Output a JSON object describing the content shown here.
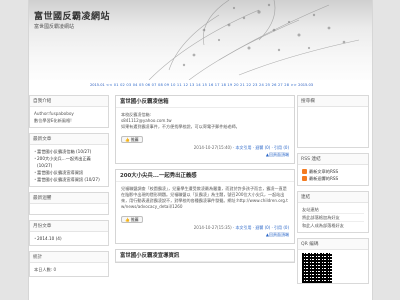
{
  "site": {
    "title": "富世國反霸凌網站",
    "subtitle": "富世國反霸凌網站"
  },
  "calendar": {
    "prev": "2015.01",
    "next": "2015.03",
    "days": "<< 01 02 03 04 05 06 07 08 09 10 11 12 13 14 15 16 17 18 19 20 21 22 23 24 25 26 27 28 >>"
  },
  "left": {
    "about": {
      "title": "自我介紹",
      "lines": [
        "Author:fuspaboboy",
        "數位學習E化新風格!"
      ]
    },
    "recent": {
      "title": "最新文章",
      "items": [
        "富世國小反霸凌信箱 (10/27)",
        "200大小尖兵...一起秀出正義",
        "(10/27)",
        "富世國小反霸凌宣導資訊",
        "富世國小反霸凌宣導資訊 (10/27)"
      ]
    },
    "latest_reply": {
      "title": "最新迴響"
    },
    "archive": {
      "title": "月份文章",
      "items": [
        "2014.10 (4)"
      ]
    },
    "stats": {
      "title": "統計",
      "lines": [
        "本日人數: 0"
      ]
    }
  },
  "posts": [
    {
      "title": "富世國小反霸凌信箱",
      "body": "本校反霸凌信箱:\ns841112@yahoo.com.tw\n如果有遇到霸凌事件，不方便找學校說，可以寄電子郵件給老師。",
      "push": "推薦",
      "meta_date": "2014-10-27(15:40)",
      "meta_stats": "‧ 本文引用 ‧ 迴響 (0) ‧ 引用 (0)",
      "back": "▲回頁面頂端"
    },
    {
      "title": "200大小尖兵...一起秀出正義感",
      "body": "兒福聯盟調查「校園霸凌」，兒童學生遭受欺凌最為嚴重，而對於許多孩子而言，霸凌一直是在陰影中出現的隱形問題。兒福聯盟以「反霸凌」為主題，號召200位大小尖兵，一起站出來，用行動表達對霸凌說不，對學校的各種霸凌事件發聲。網址:http://www.children.org.tw/news/advocacy_detail/1260",
      "push": "推薦",
      "meta_date": "2014-10-27(15:35)",
      "meta_stats": "‧ 本文引用 ‧ 迴響 (0) ‧ 引用 (0)",
      "back": "▲回頁面頂端"
    },
    {
      "title": "富世國小反霸凌宣導資訊"
    }
  ],
  "right": {
    "search": {
      "title": "搜尋欄"
    },
    "rss": {
      "title": "RSS 連結",
      "items": [
        "最新文章的RSS",
        "最新迴響的RSS"
      ]
    },
    "links": {
      "title": "連結",
      "items": [
        "友站連結",
        "將此部落格加為好友",
        "和此人成為部落格好友"
      ]
    },
    "qr": {
      "title": "QR 編碼"
    }
  }
}
